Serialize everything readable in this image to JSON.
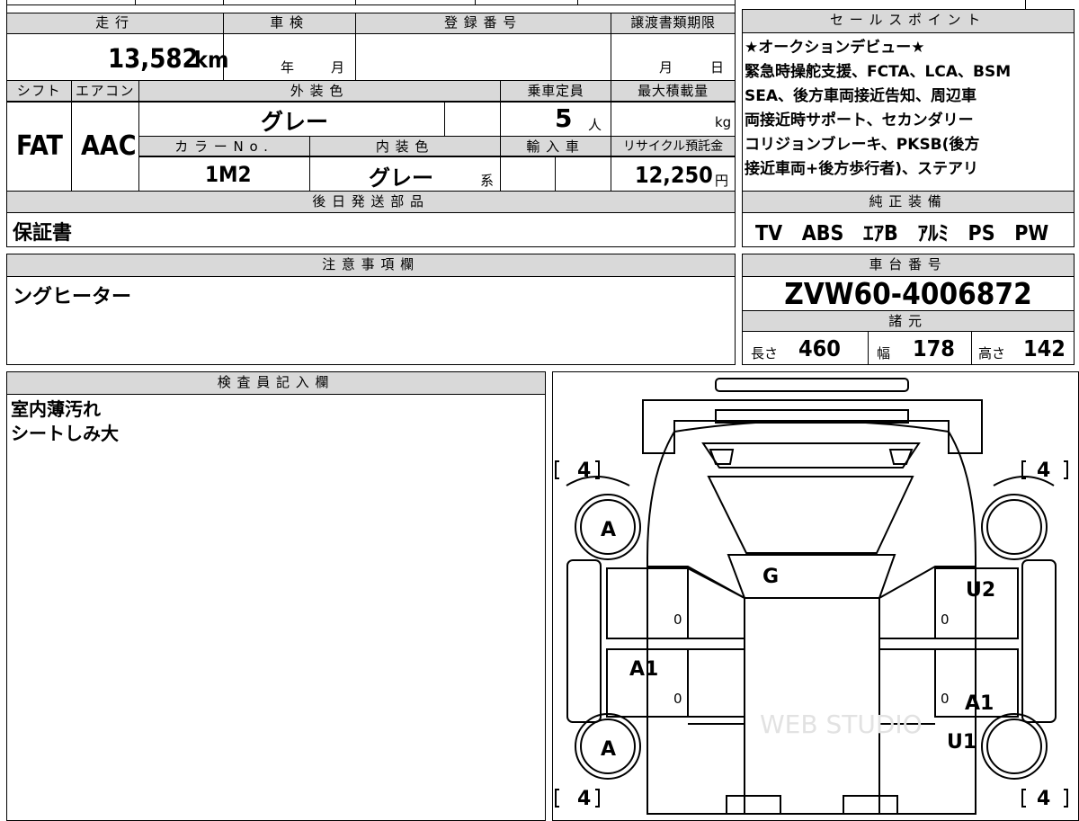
{
  "main_table": {
    "mileage_label": "走行",
    "mileage_value": "13,582",
    "mileage_unit": "km",
    "inspection_label": "車検",
    "inspection_year": "年",
    "inspection_month": "月",
    "registration_label": "登録番号",
    "transfer_docs_label": "譲渡書類期限",
    "transfer_month": "月",
    "transfer_day": "日",
    "shift_label": "シフト",
    "shift_value": "FAT",
    "aircon_label": "エアコン",
    "aircon_value": "AAC",
    "exterior_color_label": "外装色",
    "exterior_color_value": "グレー",
    "capacity_label": "乗車定員",
    "capacity_value": "5",
    "capacity_unit": "人",
    "max_load_label": "最大積載量",
    "max_load_unit": "kg",
    "color_no_label": "カラーNo.",
    "color_no_value": "1M2",
    "interior_color_label": "内装色",
    "interior_color_value": "グレー",
    "interior_color_suffix": "系",
    "import_label": "輸入車",
    "recycle_label": "リサイクル預託金",
    "recycle_value": "12,250",
    "recycle_unit": "円",
    "later_parts_label": "後日発送部品",
    "later_parts_value": "保証書"
  },
  "sales_points": {
    "label": "セールスポイント",
    "lines": [
      "★オークションデビュー★",
      "緊急時操舵支援、FCTA、LCA、BSM",
      "SEA、後方車両接近告知、周辺車",
      "両接近時サポート、セカンダリー",
      "コリジョンブレーキ、PKSB(後方",
      "接近車両+後方歩行者)、ステアリ"
    ]
  },
  "equipment": {
    "label": "純正装備",
    "items": [
      "TV",
      "ABS",
      "ｴｱB",
      "ｱﾙﾐ",
      "PS",
      "PW"
    ]
  },
  "notes": {
    "label": "注意事項欄",
    "value": "ングヒーター"
  },
  "chassis": {
    "label": "車台番号",
    "value": "ZVW60-4006872"
  },
  "specs": {
    "label": "諸元",
    "length_label": "長さ",
    "length_value": "460",
    "width_label": "幅",
    "width_value": "178",
    "height_label": "高さ",
    "height_value": "142"
  },
  "inspector": {
    "label": "検査員記入欄",
    "lines": [
      "室内薄汚れ",
      "シートしみ大"
    ]
  },
  "diagram": {
    "tire_depths": [
      "4",
      "4",
      "4",
      "4"
    ],
    "marks": {
      "front_left_wheel": "A",
      "rear_left_wheel": "A",
      "roof": "G",
      "front_right_door": "U2",
      "rear_left_door": "A1",
      "rear_right_door": "A1",
      "rear_right_quarter": "U1"
    },
    "zero_labels": [
      "0",
      "0",
      "0",
      "0"
    ],
    "watermark": "WEB STUDIO"
  }
}
